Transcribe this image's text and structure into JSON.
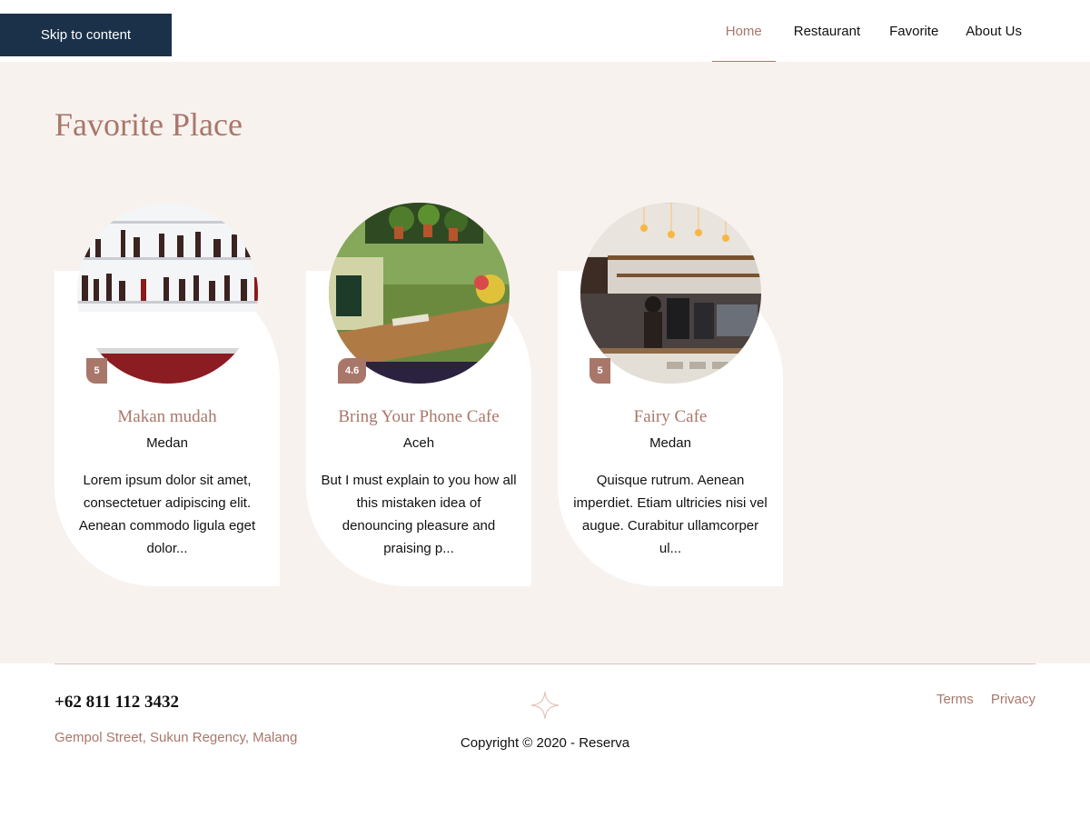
{
  "skip_link": "Skip to content",
  "nav": {
    "items": [
      {
        "label": "Home",
        "active": true
      },
      {
        "label": "Restaurant",
        "active": false
      },
      {
        "label": "Favorite",
        "active": false
      },
      {
        "label": "About Us",
        "active": false
      }
    ]
  },
  "main": {
    "title": "Favorite Place",
    "cards": [
      {
        "name": "Makan mudah",
        "city": "Medan",
        "rating": "5",
        "description": "Lorem ipsum dolor sit amet, consectetuer adipiscing elit. Aenean commodo ligula eget dolor...",
        "image": "bar-shelves-photo"
      },
      {
        "name": "Bring Your Phone Cafe",
        "city": "Aceh",
        "rating": "4.6",
        "description": "But I must explain to you how all this mistaken idea of denouncing pleasure and praising p...",
        "image": "green-cafe-table-photo"
      },
      {
        "name": "Fairy Cafe",
        "city": "Medan",
        "rating": "5",
        "description": "Quisque rutrum. Aenean imperdiet. Etiam ultricies nisi vel augue. Curabitur ullamcorper ul...",
        "image": "coffee-shop-counter-photo"
      }
    ]
  },
  "footer": {
    "phone": "+62 811 112 3432",
    "address": "Gempol Street, Sukun Regency, Malang",
    "copyright": "Copyright © 2020 - Reserva",
    "links": [
      "Terms",
      "Privacy"
    ],
    "logo_icon": "four-point-star-icon"
  },
  "colors": {
    "accent": "#a9776a",
    "skip_bg": "#1a3149",
    "section_bg": "#f8f2ef",
    "footer_line": "#dcc2ba"
  }
}
